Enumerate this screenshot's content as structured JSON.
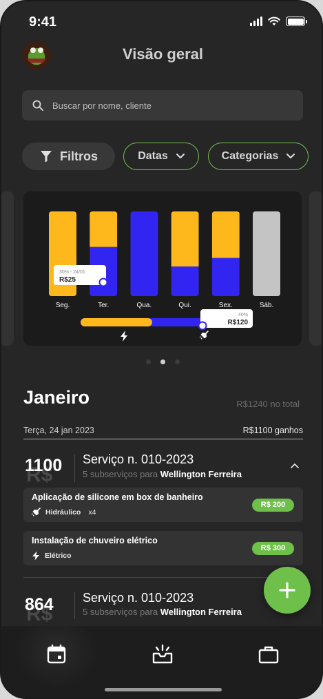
{
  "status": {
    "time": "9:41"
  },
  "header": {
    "title": "Visão geral"
  },
  "search": {
    "placeholder": "Buscar por nome, cliente"
  },
  "filters": {
    "filters_label": "Filtros",
    "dates_label": "Datas",
    "categories_label": "Categorias"
  },
  "chart_data": {
    "type": "bar",
    "categories": [
      "Seg.",
      "Ter.",
      "Qua.",
      "Qui.",
      "Sex.",
      "Sáb."
    ],
    "series": [
      {
        "values": [
          1,
          0.42,
          0,
          0.65,
          0.55,
          0
        ]
      },
      {
        "values": [
          0,
          0.58,
          1,
          0.35,
          0.45,
          0
        ]
      },
      {
        "values": [
          0,
          0,
          0,
          0,
          0,
          1
        ]
      }
    ],
    "colors": {
      "yellow": "#ffb81c",
      "blue": "#3225f2",
      "gray": "#c4c4c4"
    },
    "tooltip_day": {
      "caption": "30% - 24/01",
      "value": "R$25"
    },
    "tooltip_total": {
      "caption": "40%",
      "value": "R$120"
    },
    "progress": {
      "yellow_fraction": 0.55,
      "blue_fraction": 0.45,
      "icons": [
        "lightning-icon",
        "shower-icon"
      ]
    }
  },
  "pagination": {
    "count": 3,
    "active": 1
  },
  "month": {
    "name": "Janeiro",
    "total": "R$1240 no total"
  },
  "day": {
    "date": "Terça, 24 jan 2023",
    "earnings": "R$1100 ganhos"
  },
  "services": [
    {
      "amount": "1100",
      "currency": "R$",
      "title": "Serviço n. 010-2023",
      "subtitle_prefix": "5 subserviços para",
      "client": "Wellington Ferreira",
      "subservices": [
        {
          "name": "Aplicação de silicone em box de banheiro",
          "category": "Hidráulico",
          "qty": "x4",
          "price": "R$ 200",
          "icon": "shower-icon"
        },
        {
          "name": "Instalação de chuveiro elétrico",
          "category": "Elétrico",
          "qty": "",
          "price": "R$ 300",
          "icon": "lightning-icon"
        }
      ]
    },
    {
      "amount": "864",
      "currency": "R$",
      "title": "Serviço n. 010-2023",
      "subtitle_prefix": "5 subserviços para",
      "client": "Wellington Ferreira"
    }
  ],
  "nav": {
    "items": [
      "calendar-icon",
      "inbox-icon",
      "briefcase-icon"
    ]
  },
  "theme": {
    "accent": "#6fc04b",
    "background": "#262626"
  }
}
